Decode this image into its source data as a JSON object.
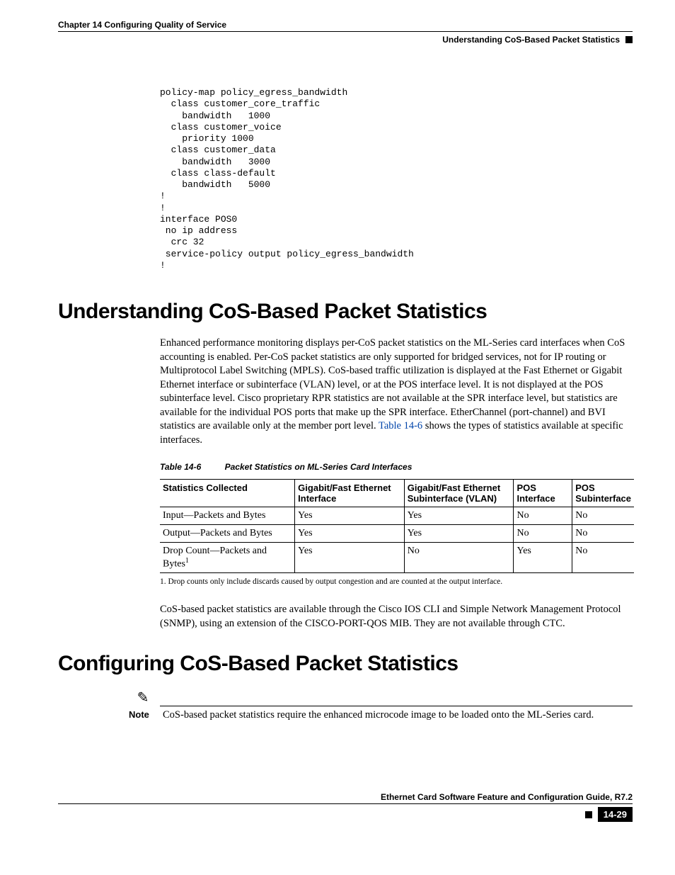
{
  "header": {
    "chapter": "Chapter 14 Configuring Quality of Service",
    "section": "Understanding CoS-Based Packet Statistics"
  },
  "code": "policy-map policy_egress_bandwidth\n  class customer_core_traffic\n    bandwidth   1000\n  class customer_voice\n    priority 1000\n  class customer_data\n    bandwidth   3000\n  class class-default\n    bandwidth   5000\n!\n!\ninterface POS0\n no ip address\n  crc 32\n service-policy output policy_egress_bandwidth\n!",
  "section1": {
    "title": "Understanding CoS-Based Packet Statistics",
    "para1a": "Enhanced performance monitoring displays per-CoS packet statistics on the ML-Series card interfaces when CoS accounting is enabled. Per-CoS packet statistics are only supported for bridged services, not for IP routing or Multiprotocol Label Switching (MPLS). CoS-based traffic utilization is displayed at the Fast Ethernet or Gigabit Ethernet interface or subinterface (VLAN) level, or at the POS interface level. It is not displayed at the POS subinterface level. Cisco proprietary RPR  statistics are not available at the SPR interface level, but statistics are available for the individual POS ports that make up the SPR interface. EtherChannel (port-channel) and BVI statistics are available only at the member port level. ",
    "para1_ref": "Table 14-6",
    "para1b": " shows the types of statistics available at specific interfaces.",
    "table": {
      "id": "Table 14-6",
      "title": "Packet Statistics on ML-Series Card Interfaces",
      "headers": [
        "Statistics Collected",
        "Gigabit/Fast Ethernet Interface",
        "Gigabit/Fast Ethernet Subinterface (VLAN)",
        "POS Interface",
        "POS Subinterface"
      ],
      "rows": [
        {
          "c0": "Input—Packets and Bytes",
          "c1": "Yes",
          "c2": "Yes",
          "c3": "No",
          "c4": "No"
        },
        {
          "c0": "Output—Packets and Bytes",
          "c1": "Yes",
          "c2": "Yes",
          "c3": "No",
          "c4": "No"
        },
        {
          "c0": "Drop Count—Packets and Bytes",
          "fn": "1",
          "c1": "Yes",
          "c2": "No",
          "c3": "Yes",
          "c4": "No"
        }
      ],
      "footnote": "1.   Drop counts only include discards caused by output congestion and are counted at the output interface."
    },
    "para2": "CoS-based packet statistics are available through the Cisco IOS CLI and Simple Network Management Protocol (SNMP), using an extension of the CISCO-PORT-QOS MIB. They are not available through CTC."
  },
  "section2": {
    "title": "Configuring CoS-Based Packet Statistics",
    "note_label": "Note",
    "note_text": "CoS-based packet statistics require the enhanced microcode image to be loaded onto the ML-Series card."
  },
  "footer": {
    "doc_title": "Ethernet Card Software Feature and Configuration Guide, R7.2",
    "page": "14-29"
  }
}
